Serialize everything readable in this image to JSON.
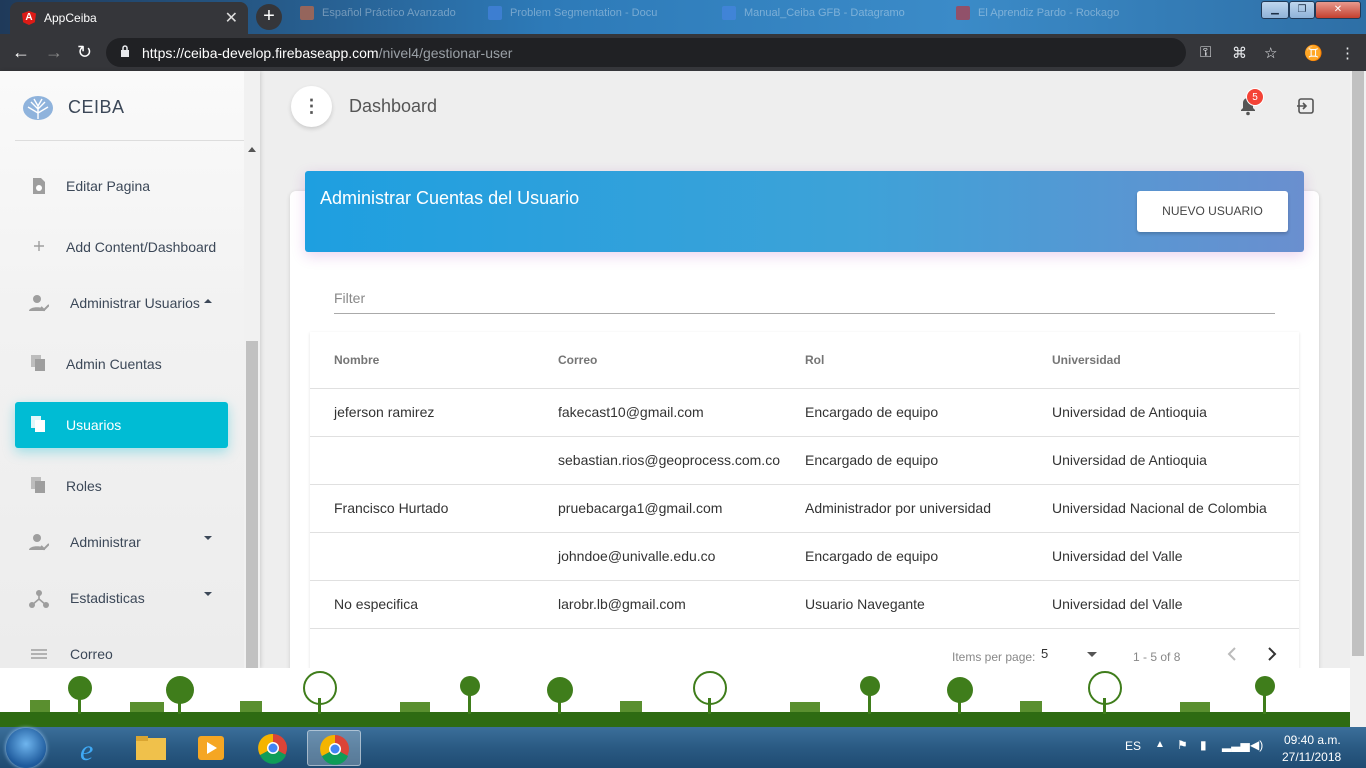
{
  "browser": {
    "active_tab_title": "AppCeiba",
    "background_tabs": [
      {
        "label": "Español Práctico Avanzado"
      },
      {
        "label": "Problem Segmentation - Docu"
      },
      {
        "label": "Manual_Ceiba GFB - Datagramo"
      },
      {
        "label": "El Aprendiz Pardo - Rockago"
      }
    ],
    "url_host": "https://ceiba-develop.firebaseapp.com",
    "url_path": "/nivel4/gestionar-user"
  },
  "sidebar": {
    "brand": "CEIBA",
    "items": [
      {
        "label": "Editar Pagina",
        "icon": "page-edit-icon"
      },
      {
        "label": "Add Content/Dashboard",
        "icon": "plus-icon"
      },
      {
        "label": "Administrar Usuarios",
        "icon": "user-check-icon"
      },
      {
        "label": "Admin Cuentas",
        "icon": "copy-icon"
      },
      {
        "label": "Usuarios",
        "icon": "copy-icon"
      },
      {
        "label": "Roles",
        "icon": "copy-icon"
      },
      {
        "label": "Administrar",
        "icon": "user-check-icon"
      },
      {
        "label": "Estadisticas",
        "icon": "hub-icon"
      },
      {
        "label": "Correo",
        "icon": "list-icon"
      }
    ],
    "active_item": "Usuarios"
  },
  "header": {
    "title": "Dashboard",
    "notification_count": "5"
  },
  "card": {
    "title": "Administrar Cuentas del Usuario",
    "new_user_button": "NUEVO USUARIO",
    "filter_placeholder": "Filter"
  },
  "table": {
    "columns": [
      "Nombre",
      "Correo",
      "Rol",
      "Universidad"
    ],
    "rows": [
      [
        "jeferson ramirez",
        "fakecast10@gmail.com",
        "Encargado de equipo",
        "Universidad de Antioquia"
      ],
      [
        "",
        "sebastian.rios@geoprocess.com.co",
        "Encargado de equipo",
        "Universidad de Antioquia"
      ],
      [
        "Francisco Hurtado",
        "pruebacarga1@gmail.com",
        "Administrador por universidad",
        "Universidad Nacional de Colombia"
      ],
      [
        "",
        "johndoe@univalle.edu.co",
        "Encargado de equipo",
        "Universidad del Valle"
      ],
      [
        "No especifica",
        "larobr.lb@gmail.com",
        "Usuario Navegante",
        "Universidad del Valle"
      ]
    ]
  },
  "paginator": {
    "items_per_page_label": "Items per page:",
    "page_size": "5",
    "range_label": "1 - 5 of 8"
  },
  "taskbar": {
    "language": "ES",
    "time": "09:40 a.m.",
    "date": "27/11/2018"
  },
  "colors": {
    "sidebar_active": "#00bcd4",
    "header_gradient_start": "#1e9fe0",
    "header_gradient_end": "#6a8fcf",
    "badge": "#f44336",
    "footer_green": "#2e6b12"
  }
}
